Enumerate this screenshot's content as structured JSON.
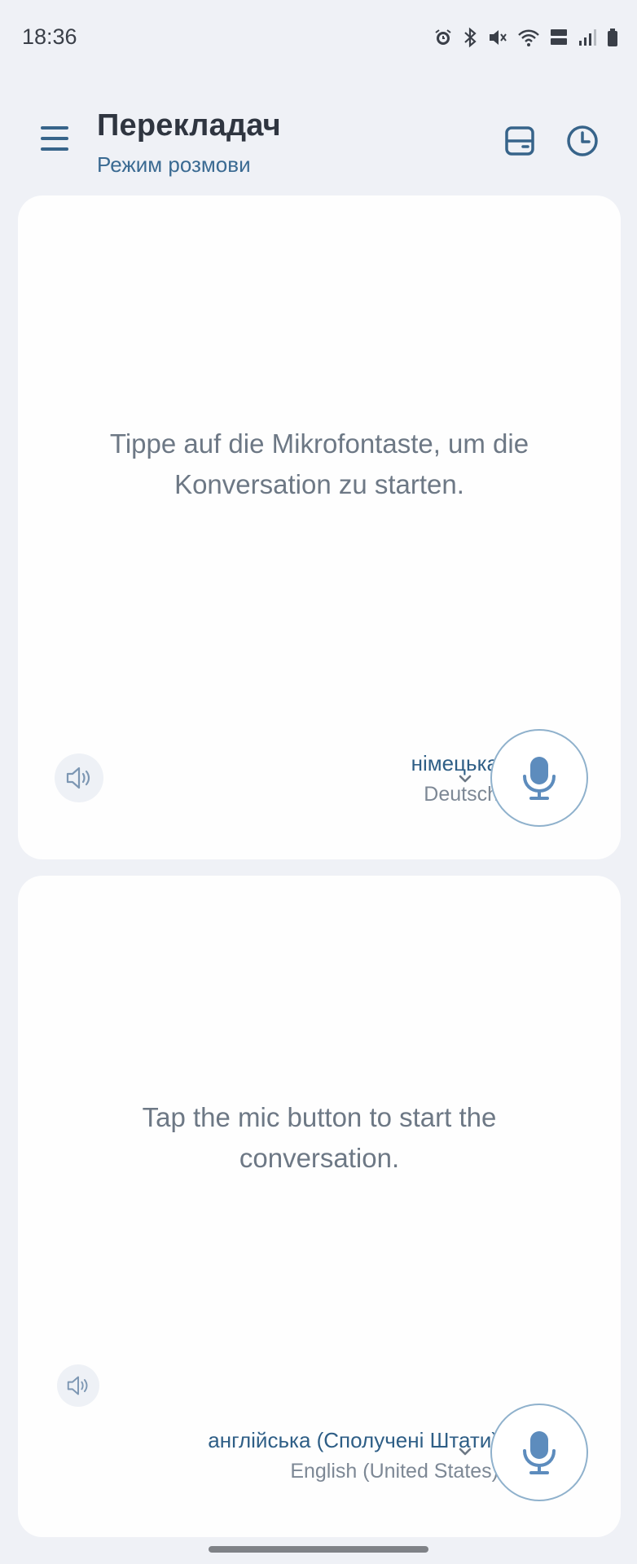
{
  "status": {
    "time": "18:36",
    "icons": [
      "alarm-icon",
      "bluetooth-icon",
      "mute-icon",
      "wifi-icon",
      "volte-lte-icon",
      "signal-icon",
      "battery-icon"
    ]
  },
  "header": {
    "title": "Перекладач",
    "subtitle": "Режим розмови",
    "icons": [
      "menu-icon",
      "cards-icon",
      "history-icon"
    ]
  },
  "top_panel": {
    "prompt": "Tippe auf die Mikrofontaste, um die Konversation zu starten.",
    "language_name": "німецька",
    "language_native": "Deutsch"
  },
  "bottom_panel": {
    "prompt": "Tap the mic button to start the conversation.",
    "language_name": "англійська (Сполучені Штати)",
    "language_native": "English (United States)"
  },
  "colors": {
    "background": "#eff1f6",
    "panel": "#fefefe",
    "accent": "#37648a",
    "mic_border": "#8fb1cc"
  }
}
